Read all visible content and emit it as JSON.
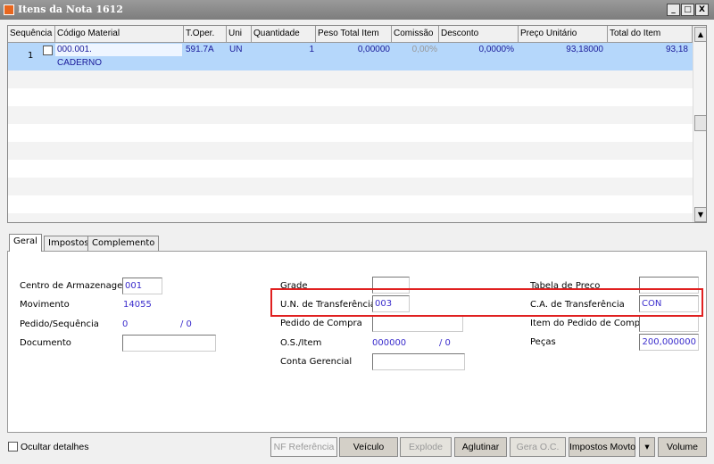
{
  "window": {
    "title": "Itens da Nota 1612",
    "minimize": "_",
    "maximize": "□",
    "close": "X"
  },
  "grid": {
    "columns": [
      "Sequência",
      "Código Material",
      "T.Oper.",
      "Uni",
      "Quantidade",
      "Peso Total Item",
      "Comissão",
      "Desconto",
      "Preço Unitário",
      "Total do Item"
    ],
    "rows": [
      {
        "sequencia": "1",
        "checked": false,
        "codigo": "000.001.",
        "descricao": "CADERNO",
        "toper": "591.7A",
        "uni": "UN",
        "quantidade": "1",
        "peso": "0,00000",
        "comissao": "0,00%",
        "desconto": "0,0000%",
        "preco": "93,18000",
        "total": "93,18"
      }
    ],
    "colors": {
      "selected_row": "#b5d7fb"
    }
  },
  "tabs": [
    {
      "label": "Geral",
      "active": true
    },
    {
      "label": "Impostos"
    },
    {
      "label": "Complemento"
    }
  ],
  "form": {
    "centro_label": "Centro de Armazenagem",
    "centro_value": "001",
    "movimento_label": "Movimento",
    "movimento_value": "14055",
    "pedido_seq_label": "Pedido/Sequência",
    "pedido_value": "0",
    "sequencia_value": "/ 0",
    "documento_label": "Documento",
    "documento_value": "",
    "grade_label": "Grade",
    "grade_value": "",
    "un_transf_label": "U.N. de Transferência",
    "un_transf_value": "003",
    "pedido_compra_label": "Pedido de Compra",
    "pedido_compra_value": "",
    "os_item_label": "O.S./Item",
    "os_value": "000000",
    "item_value": "/ 0",
    "conta_label": "Conta Gerencial",
    "conta_value": "",
    "tabela_label": "Tabela de Preco",
    "tabela_value": "",
    "ca_transf_label": "C.A. de Transferência",
    "ca_transf_value": "CON",
    "item_pedido_label": "Item do Pedido de Compra",
    "item_pedido_value": "",
    "pecas_label": "Peças",
    "pecas_value": "200,000000",
    "highlight_color": "#e02020"
  },
  "footer": {
    "ocultar_label": "Ocultar detalhes",
    "ocultar_checked": false,
    "buttons": [
      {
        "label": "NF Referência",
        "enabled": false
      },
      {
        "label": "Veículo",
        "enabled": true
      },
      {
        "label": "Explode",
        "enabled": false
      },
      {
        "label": "Aglutinar",
        "enabled": true
      },
      {
        "label": "Gera O.C.",
        "enabled": false
      },
      {
        "label": "Impostos Movto",
        "enabled": true
      },
      {
        "label": "▾",
        "enabled": true
      },
      {
        "label": "Volume",
        "enabled": true
      }
    ]
  }
}
